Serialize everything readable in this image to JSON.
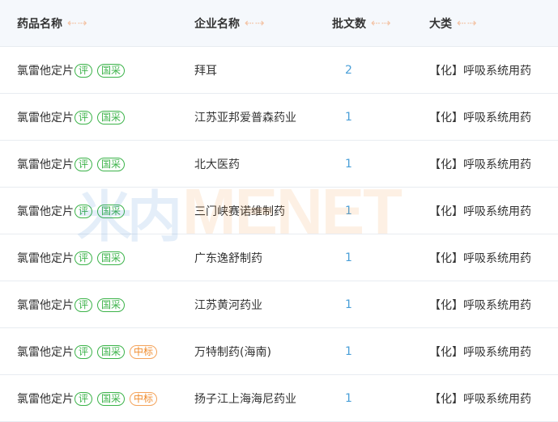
{
  "columns": [
    {
      "label": "药品名称",
      "sort_icon": "↔"
    },
    {
      "label": "企业名称",
      "sort_icon": "↔"
    },
    {
      "label": "批文数",
      "sort_icon": "↔"
    },
    {
      "label": "大类",
      "sort_icon": "↔"
    }
  ],
  "sort_arrows": "⇠⇢",
  "rows": [
    {
      "drug": "氯雷他定片",
      "tags": [
        "评",
        "国采"
      ],
      "company": "拜耳",
      "count": "2",
      "category": "【化】呼吸系统用药"
    },
    {
      "drug": "氯雷他定片",
      "tags": [
        "评",
        "国采"
      ],
      "company": "江苏亚邦爱普森药业",
      "count": "1",
      "category": "【化】呼吸系统用药"
    },
    {
      "drug": "氯雷他定片",
      "tags": [
        "评",
        "国采"
      ],
      "company": "北大医药",
      "count": "1",
      "category": "【化】呼吸系统用药"
    },
    {
      "drug": "氯雷他定片",
      "tags": [
        "评",
        "国采"
      ],
      "company": "三门峡赛诺维制药",
      "count": "1",
      "category": "【化】呼吸系统用药"
    },
    {
      "drug": "氯雷他定片",
      "tags": [
        "评",
        "国采"
      ],
      "company": "广东逸舒制药",
      "count": "1",
      "category": "【化】呼吸系统用药"
    },
    {
      "drug": "氯雷他定片",
      "tags": [
        "评",
        "国采"
      ],
      "company": "江苏黄河药业",
      "count": "1",
      "category": "【化】呼吸系统用药"
    },
    {
      "drug": "氯雷他定片",
      "tags": [
        "评",
        "国采",
        "中标"
      ],
      "company": "万特制药(海南)",
      "count": "1",
      "category": "【化】呼吸系统用药"
    },
    {
      "drug": "氯雷他定片",
      "tags": [
        "评",
        "国采",
        "中标"
      ],
      "company": "扬子江上海海尼药业",
      "count": "1",
      "category": "【化】呼吸系统用药"
    }
  ],
  "tag_colors": {
    "评": "#3cb34a",
    "国采": "#3cb34a",
    "中标": "#f08c2e"
  },
  "watermark": {
    "cn": "米内",
    "en": "MENET"
  }
}
